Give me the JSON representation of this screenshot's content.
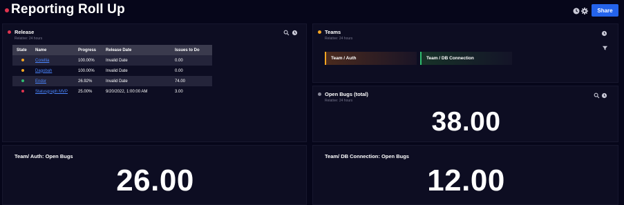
{
  "app": {
    "title": "Reporting Roll Up",
    "share_label": "Share",
    "status_color": "#e0344f",
    "icons": [
      "clock-icon",
      "gear-icon"
    ]
  },
  "release": {
    "title": "Release",
    "subtitle": "Relative: 24 hours",
    "dot_color": "#e0344f",
    "columns": [
      "State",
      "Name",
      "Progress",
      "Release Date",
      "Issues to Do"
    ],
    "rows": [
      {
        "state_color": "#f5a623",
        "name": "Corellia",
        "progress": "100.00%",
        "release_date": "Invalid Date",
        "issues": "0.00"
      },
      {
        "state_color": "#f5a623",
        "name": "Dagobah",
        "progress": "100.00%",
        "release_date": "Invalid Date",
        "issues": "0.00"
      },
      {
        "state_color": "#2fbf71",
        "name": "Endor",
        "progress": "26.92%",
        "release_date": "Invalid Date",
        "issues": "74.00"
      },
      {
        "state_color": "#e0344f",
        "name": "Statusgraph MVP",
        "progress": "25.00%",
        "release_date": "9/20/2022, 1:00:00 AM",
        "issues": "3.00"
      }
    ]
  },
  "teams": {
    "title": "Teams",
    "subtitle": "Relative: 24 hours",
    "dot_color": "#f5a623",
    "items": [
      {
        "label": "Team / Auth",
        "color": "#f5a623"
      },
      {
        "label": "Team / DB Connection",
        "color": "#2fbf71"
      }
    ]
  },
  "open_bugs": {
    "title": "Open Bugs (total)",
    "subtitle": "Relative: 24 hours",
    "dot_color": "#8a8a9a",
    "value": "38.00"
  },
  "auth_bugs": {
    "title": "Team/ Auth: Open Bugs",
    "value": "26.00"
  },
  "db_bugs": {
    "title": "Team/ DB Connection: Open Bugs",
    "value": "12.00"
  }
}
